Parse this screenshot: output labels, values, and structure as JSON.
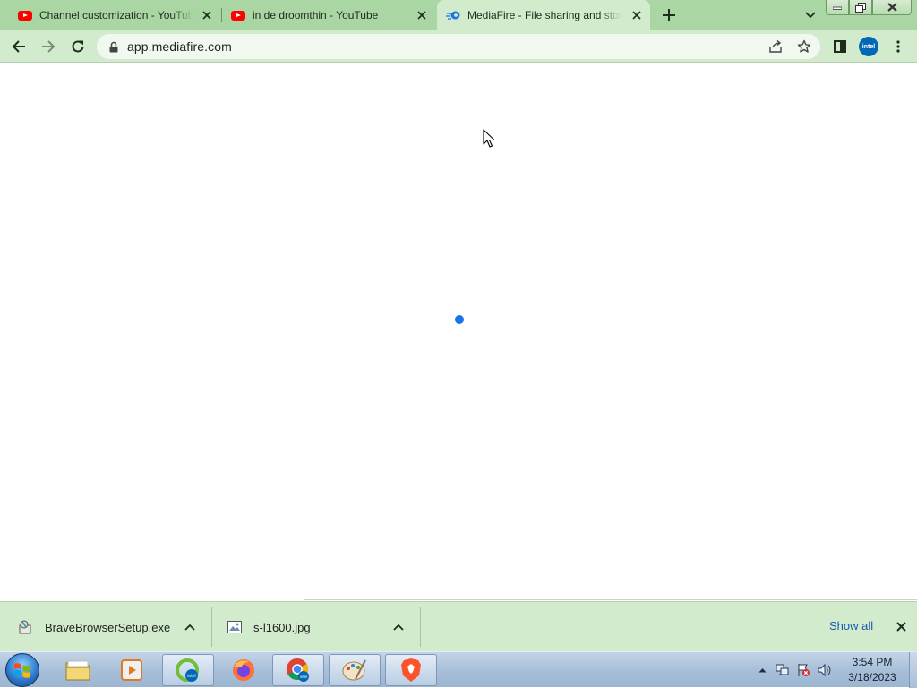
{
  "browser": {
    "tabs": [
      {
        "title": "Channel customization - YouTube",
        "favicon": "youtube-icon",
        "active": false
      },
      {
        "title": "in de droomthin - YouTube",
        "favicon": "youtube-icon",
        "active": false
      },
      {
        "title": "MediaFire - File sharing and storage",
        "favicon": "mediafire-icon",
        "active": true
      }
    ],
    "address_bar": {
      "url": "app.mediafire.com"
    },
    "profile_label": "intel"
  },
  "colors": {
    "frame": "#a9d6a3",
    "toolbar": "#d2ebcc",
    "spinner": "#1a73e8",
    "link": "#1a58b5"
  },
  "downloads": {
    "items": [
      {
        "name": "BraveBrowserSetup.exe",
        "icon": "installer-icon"
      },
      {
        "name": "s-l1600.jpg",
        "icon": "image-file-icon"
      }
    ],
    "show_all_label": "Show all"
  },
  "taskbar": {
    "apps": [
      "file-explorer-icon",
      "media-player-icon",
      "intel-graphics-icon",
      "firefox-icon",
      "chrome-icon",
      "paint-icon",
      "brave-icon"
    ],
    "clock": {
      "time": "3:54 PM",
      "date": "3/18/2023"
    }
  }
}
